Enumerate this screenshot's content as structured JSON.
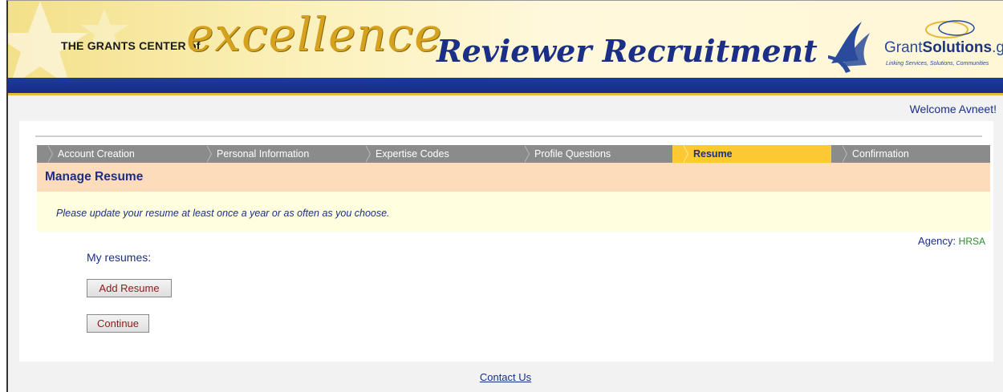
{
  "banner": {
    "brand_small": "THE GRANTS CENTER of",
    "brand_big": "excellence",
    "title": "Reviewer Recruitment",
    "logo_grant": "Grant",
    "logo_solutions": "Solutions",
    "logo_gov": ".gov",
    "logo_tagline": "Linking Services, Solutions, Communities"
  },
  "welcome": "Welcome Avneet!",
  "steps": [
    {
      "label": "Account Creation",
      "active": false
    },
    {
      "label": "Personal Information",
      "active": false
    },
    {
      "label": "Expertise Codes",
      "active": false
    },
    {
      "label": "Profile Questions",
      "active": false
    },
    {
      "label": "Resume",
      "active": true
    },
    {
      "label": "Confirmation",
      "active": false
    }
  ],
  "section": {
    "title": "Manage Resume",
    "notice": "Please update your resume at least once a year or as often as you choose."
  },
  "agency": {
    "label": "Agency:",
    "value": "HRSA"
  },
  "resumes": {
    "label": "My resumes:",
    "add_button": "Add Resume",
    "continue_button": "Continue"
  },
  "footer": {
    "contact": "Contact Us"
  },
  "colors": {
    "navy": "#1b2f86",
    "active_step": "#fcc833",
    "inactive_step": "#8b8b8b",
    "section_head": "#fddcbc",
    "notice_bg": "#ffffe0",
    "agency_value": "#2d8a2d",
    "button_text": "#8b1a1a"
  }
}
